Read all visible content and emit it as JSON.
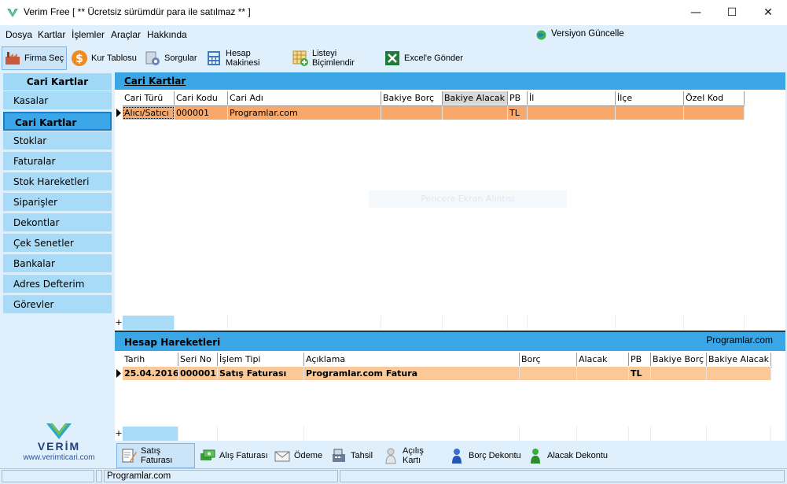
{
  "window": {
    "title": "Verim Free  [  ** Ücretsiz sürümdür para ile satılmaz **  ]",
    "min": "—",
    "max": "☐",
    "close": "✕"
  },
  "menu": {
    "items": [
      "Dosya",
      "Kartlar",
      "İşlemler",
      "Araçlar",
      "Hakkında"
    ],
    "version": "Versiyon Güncelle"
  },
  "toolbar": {
    "items": [
      "Firma Seç",
      "Kur Tablosu",
      "Sorgular",
      "Hesap Makinesi",
      "Listeyi Biçimlendir",
      "Excel'e Gönder"
    ]
  },
  "sidebar": {
    "header": "Cari Kartlar",
    "items": [
      "Kasalar",
      "Cari Kartlar",
      "Stoklar",
      "Faturalar",
      "Stok Hareketleri",
      "Siparişler",
      "Dekontlar",
      "Çek Senetler",
      "Bankalar",
      "Adres Defterim",
      "Görevler"
    ],
    "logo_text": "VERİM",
    "logo_url": "www.verimticari.com"
  },
  "cari": {
    "title": "Cari Kartlar",
    "columns": [
      "Cari Türü",
      "Cari Kodu",
      "Cari Adı",
      "Bakiye Borç",
      "Bakiye Alacak",
      "PB",
      "İl",
      "İlçe",
      "Özel Kod"
    ],
    "rows": [
      [
        "Alıcı/Satıcı",
        "000001",
        "Programlar.com",
        "",
        "",
        "TL",
        "",
        "",
        ""
      ]
    ],
    "overlay": "Pencere Ekran Alıntısı",
    "add": "+"
  },
  "hareket": {
    "title": "Hesap Hareketleri",
    "company": "Programlar.com",
    "columns": [
      "Tarih",
      "Seri No",
      "İşlem Tipi",
      "Açıklama",
      "Borç",
      "Alacak",
      "PB",
      "Bakiye Borç",
      "Bakiye Alacak"
    ],
    "rows": [
      [
        "25.04.2016",
        "000001",
        "Satış Faturası",
        "Programlar.com Fatura",
        "",
        "",
        "TL",
        "",
        ""
      ]
    ],
    "add": "+"
  },
  "bottombar": {
    "items": [
      "Satış Faturası",
      "Alış Faturası",
      "Ödeme",
      "Tahsil",
      "Açılış Kartı",
      "Borç Dekontu",
      "Alacak Dekontu"
    ]
  },
  "status": {
    "company": "Programlar.com"
  },
  "colors": {
    "accent": "#3aa6e6",
    "row_selected": "#f7a86a",
    "sidebar_item": "#a7dbf8"
  }
}
